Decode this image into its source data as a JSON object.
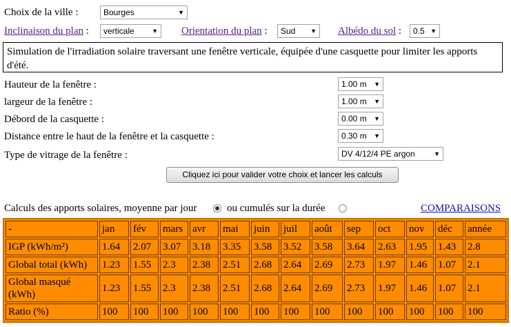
{
  "form": {
    "ville_label": "Choix de la ville :",
    "ville_value": "Bourges",
    "inclinaison_label": "Inclinaison du plan",
    "inclinaison_value": "verticale",
    "orientation_label": "Orientation du plan",
    "orientation_value": "Sud",
    "albedo_label": "Albédo du sol",
    "albedo_value": "0.5",
    "colon": ":"
  },
  "description": "Simulation de l'irradiation solaire traversant une fenêtre verticale, équipée d'une casquette pour limiter les apports d'été.",
  "params": [
    {
      "label": "Hauteur de la fenêtre :",
      "value": "1.00 m"
    },
    {
      "label": "largeur de la fenêtre :",
      "value": "1.00 m"
    },
    {
      "label": "Débord de la casquette :",
      "value": "0.00 m"
    },
    {
      "label": "Distance entre le haut de la fenêtre et la casquette :",
      "value": "0.30 m"
    },
    {
      "label": "Type de vitrage de la fenêtre :",
      "value": "DV 4/12/4 PE argon"
    }
  ],
  "submit_label": "Cliquez ici pour valider votre choix et lancer les calculs",
  "calc": {
    "label_avg": "Calculs des apports solaires, moyenne par jour",
    "label_sum": "ou cumulés sur la durée",
    "comparaisons": "COMPARAISONS"
  },
  "table": {
    "headers": [
      "-",
      "jan",
      "fév",
      "mars",
      "avr",
      "mai",
      "juin",
      "juil",
      "août",
      "sep",
      "oct",
      "nov",
      "déc",
      "année"
    ],
    "rows": [
      {
        "label": "IGP (kWh/m²)",
        "values": [
          "1.64",
          "2.07",
          "3.07",
          "3.18",
          "3.35",
          "3.58",
          "3.52",
          "3.58",
          "3.64",
          "2.63",
          "1.95",
          "1.43",
          "2.8"
        ]
      },
      {
        "label": "Global total (kWh)",
        "values": [
          "1.23",
          "1.55",
          "2.3",
          "2.38",
          "2.51",
          "2.68",
          "2.64",
          "2.69",
          "2.73",
          "1.97",
          "1.46",
          "1.07",
          "2.1"
        ]
      },
      {
        "label": "Global masqué (kWh)",
        "values": [
          "1.23",
          "1.55",
          "2.3",
          "2.38",
          "2.51",
          "2.68",
          "2.64",
          "2.69",
          "2.73",
          "1.97",
          "1.46",
          "1.07",
          "2.1"
        ]
      },
      {
        "label": "Ratio (%)",
        "values": [
          "100",
          "100",
          "100",
          "100",
          "100",
          "100",
          "100",
          "100",
          "100",
          "100",
          "100",
          "100",
          "100"
        ]
      }
    ]
  }
}
